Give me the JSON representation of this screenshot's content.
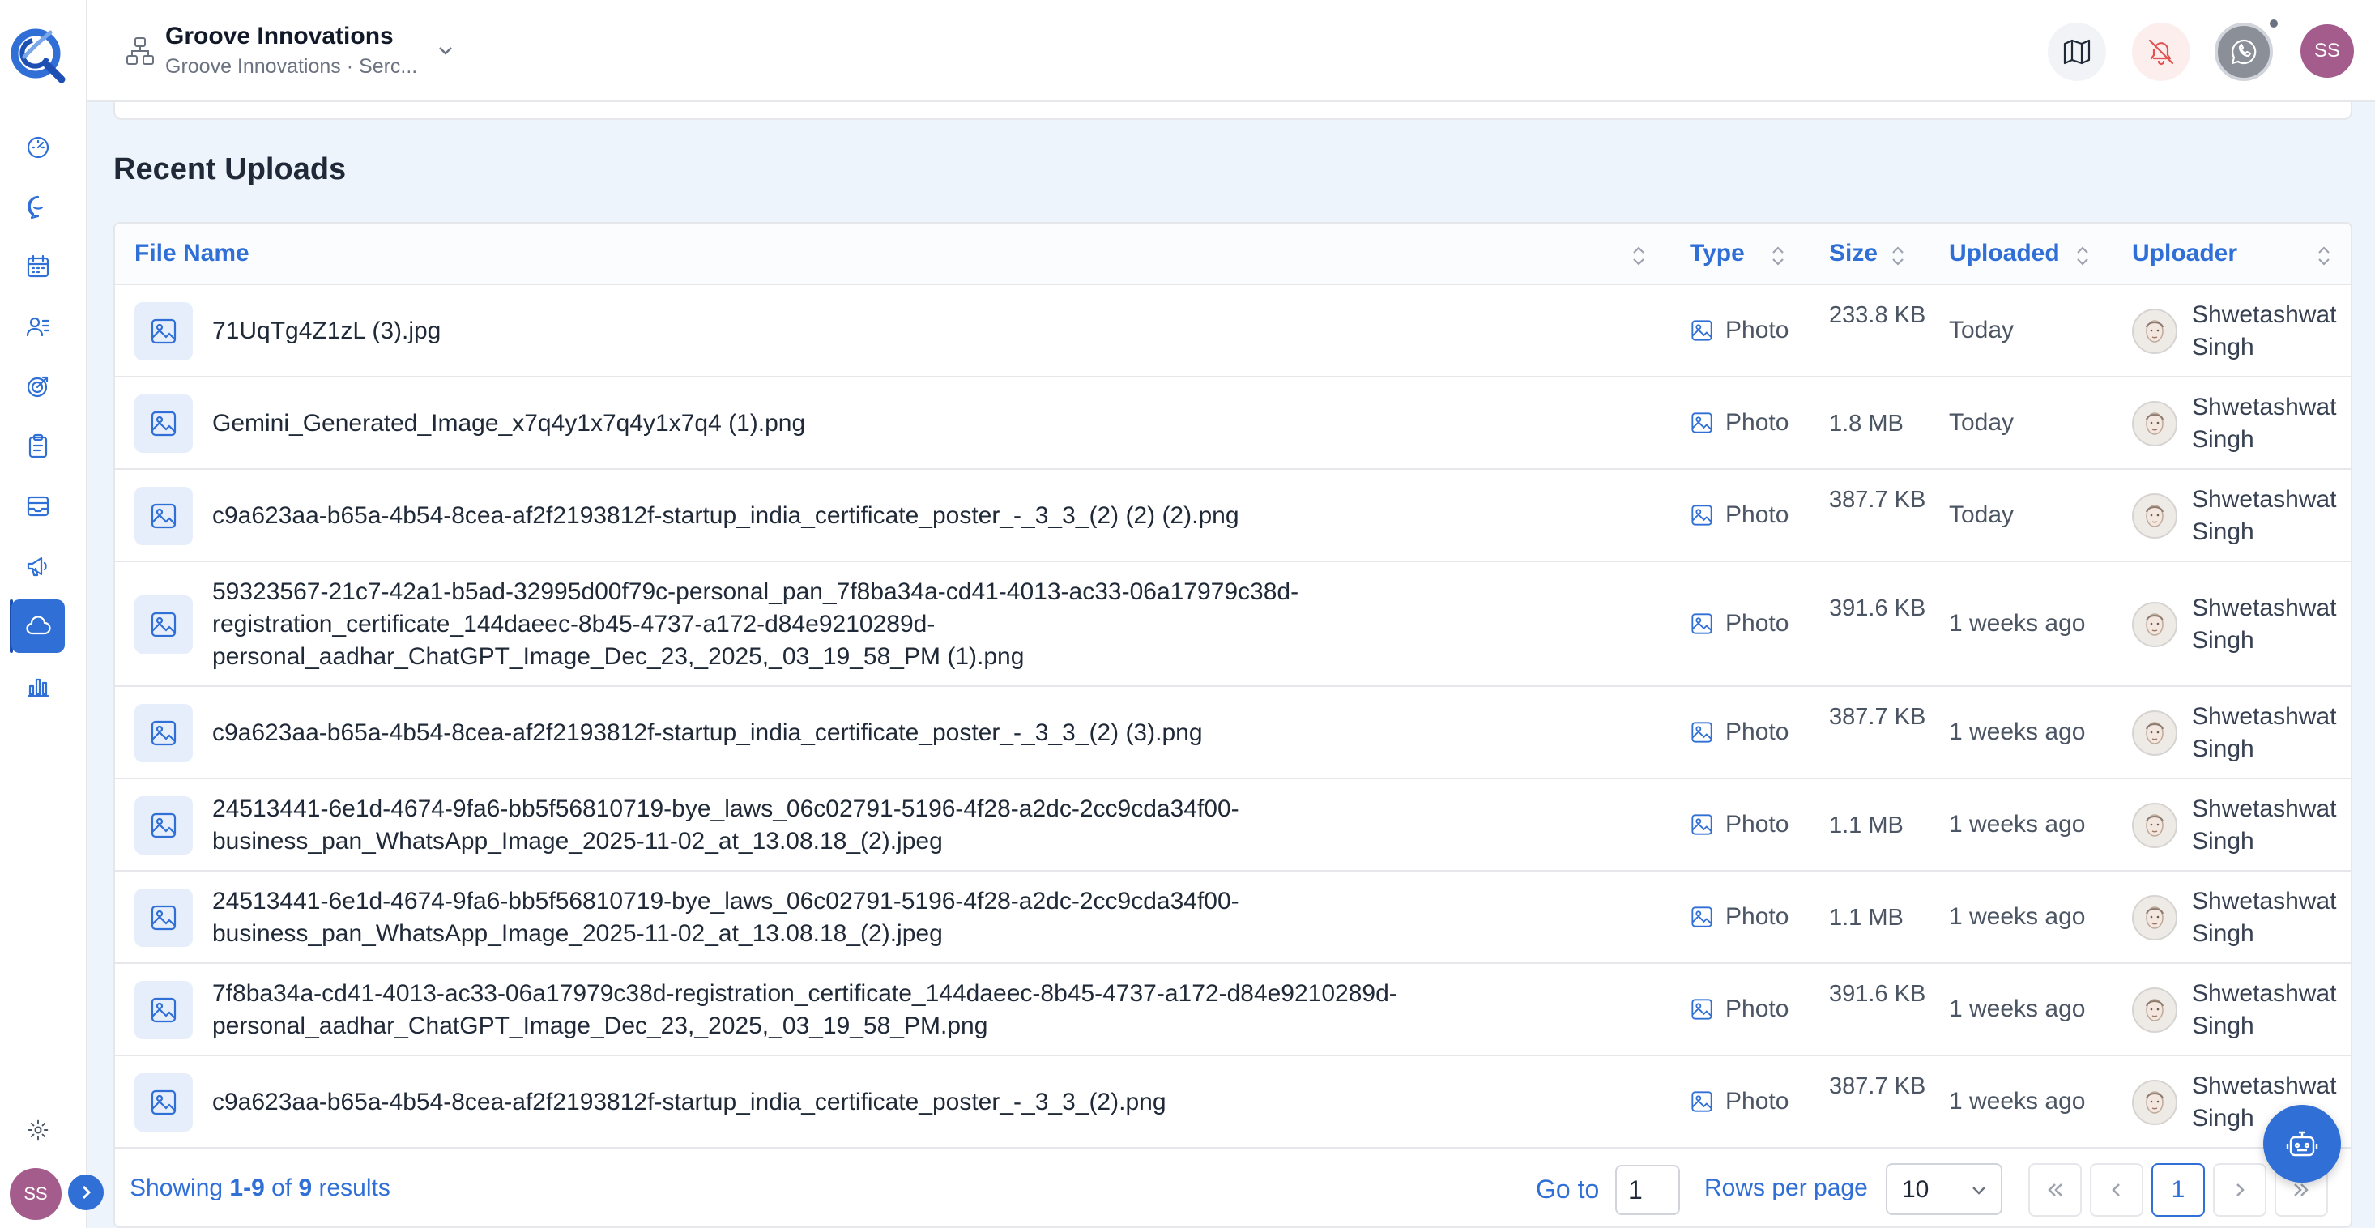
{
  "header": {
    "org_name": "Groove Innovations",
    "org_sub": "Groove Innovations · Serc..."
  },
  "user": {
    "initials": "SS"
  },
  "section": {
    "title": "Recent Uploads"
  },
  "table": {
    "columns": {
      "file_name": "File Name",
      "type": "Type",
      "size": "Size",
      "uploaded": "Uploaded",
      "uploader": "Uploader"
    },
    "rows": [
      {
        "name": "71UqTg4Z1zL (3).jpg",
        "type": "Photo",
        "size": "233.8 KB",
        "uploaded": "Today",
        "uploader": "Shwetashwat Singh"
      },
      {
        "name": "Gemini_Generated_Image_x7q4y1x7q4y1x7q4 (1).png",
        "type": "Photo",
        "size": "1.8 MB",
        "uploaded": "Today",
        "uploader": "Shwetashwat Singh"
      },
      {
        "name": "c9a623aa-b65a-4b54-8cea-af2f2193812f-startup_india_certificate_poster_-_3_3_(2) (2) (2).png",
        "type": "Photo",
        "size": "387.7 KB",
        "uploaded": "Today",
        "uploader": "Shwetashwat Singh"
      },
      {
        "name": "59323567-21c7-42a1-b5ad-32995d00f79c-personal_pan_7f8ba34a-cd41-4013-ac33-06a17979c38d-registration_certificate_144daeec-8b45-4737-a172-d84e9210289d-personal_aadhar_ChatGPT_Image_Dec_23,_2025,_03_19_58_PM (1).png",
        "type": "Photo",
        "size": "391.6 KB",
        "uploaded": "1 weeks ago",
        "uploader": "Shwetashwat Singh"
      },
      {
        "name": "c9a623aa-b65a-4b54-8cea-af2f2193812f-startup_india_certificate_poster_-_3_3_(2) (3).png",
        "type": "Photo",
        "size": "387.7 KB",
        "uploaded": "1 weeks ago",
        "uploader": "Shwetashwat Singh"
      },
      {
        "name": "24513441-6e1d-4674-9fa6-bb5f56810719-bye_laws_06c02791-5196-4f28-a2dc-2cc9cda34f00-business_pan_WhatsApp_Image_2025-11-02_at_13.08.18_(2).jpeg",
        "type": "Photo",
        "size": "1.1 MB",
        "uploaded": "1 weeks ago",
        "uploader": "Shwetashwat Singh"
      },
      {
        "name": "24513441-6e1d-4674-9fa6-bb5f56810719-bye_laws_06c02791-5196-4f28-a2dc-2cc9cda34f00-business_pan_WhatsApp_Image_2025-11-02_at_13.08.18_(2).jpeg",
        "type": "Photo",
        "size": "1.1 MB",
        "uploaded": "1 weeks ago",
        "uploader": "Shwetashwat Singh"
      },
      {
        "name": "7f8ba34a-cd41-4013-ac33-06a17979c38d-registration_certificate_144daeec-8b45-4737-a172-d84e9210289d-personal_aadhar_ChatGPT_Image_Dec_23,_2025,_03_19_58_PM.png",
        "type": "Photo",
        "size": "391.6 KB",
        "uploaded": "1 weeks ago",
        "uploader": "Shwetashwat Singh"
      },
      {
        "name": "c9a623aa-b65a-4b54-8cea-af2f2193812f-startup_india_certificate_poster_-_3_3_(2).png",
        "type": "Photo",
        "size": "387.7 KB",
        "uploaded": "1 weeks ago",
        "uploader": "Shwetashwat Singh"
      }
    ]
  },
  "footer": {
    "showing_prefix": "Showing ",
    "range": "1-9",
    "of": " of ",
    "total": "9",
    "suffix": " results",
    "goto_label": "Go to",
    "goto_value": "1",
    "rows_label": "Rows per page",
    "rows_value": "10",
    "current_page": "1"
  },
  "icons": {
    "sidebar": [
      "dashboard-icon",
      "chat-icon",
      "calendar-icon",
      "users-list-icon",
      "target-icon",
      "clipboard-icon",
      "inbox-icon",
      "megaphone-icon",
      "cloud-icon",
      "bar-chart-icon"
    ],
    "header": [
      "map-icon",
      "bell-off-icon",
      "whatsapp-icon"
    ]
  },
  "colors": {
    "accent": "#2f6fd6",
    "avatar": "#a45c8c",
    "bell_bg": "#fdeeee"
  }
}
